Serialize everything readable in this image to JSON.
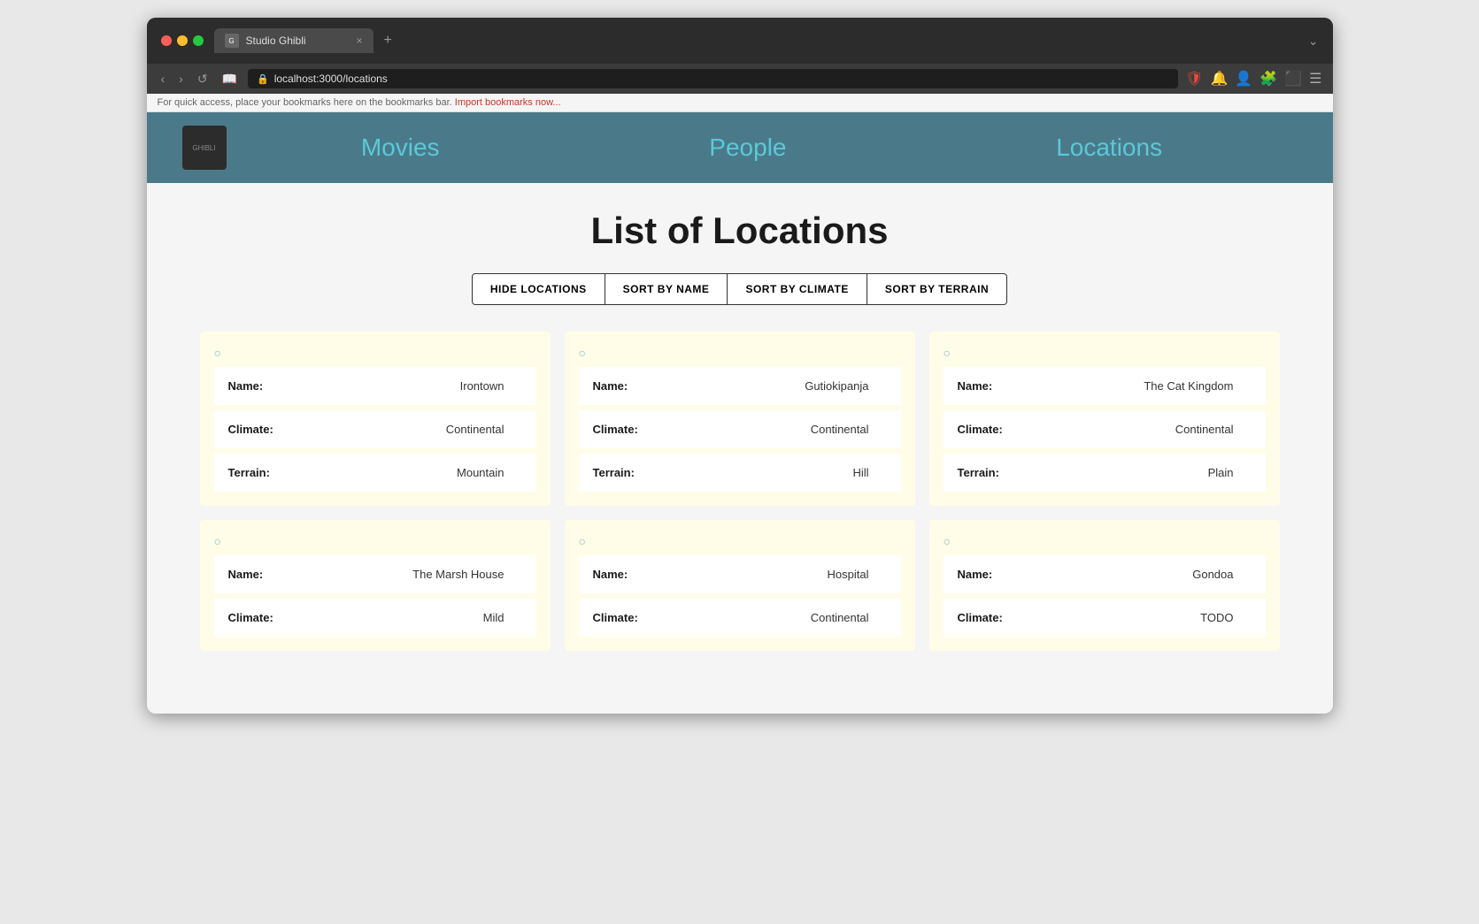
{
  "browser": {
    "tab_title": "Studio Ghibli",
    "url": "localhost:3000/locations",
    "bookmarks_text": "For quick access, place your bookmarks here on the bookmarks bar.",
    "import_link": "Import bookmarks now...",
    "new_tab_symbol": "+",
    "close_tab_symbol": "×"
  },
  "nav": {
    "logo_text": "GHIBLI",
    "links": [
      {
        "label": "Movies",
        "href": "#movies",
        "active": false
      },
      {
        "label": "People",
        "href": "#people",
        "active": false
      },
      {
        "label": "Locations",
        "href": "#locations",
        "active": true
      }
    ]
  },
  "page": {
    "title": "List of Locations",
    "buttons": [
      {
        "id": "hide",
        "label": "HIDE LOCATIONS"
      },
      {
        "id": "name",
        "label": "SORT BY NAME"
      },
      {
        "id": "climate",
        "label": "SORT BY CLIMATE"
      },
      {
        "id": "terrain",
        "label": "SORT BY TERRAIN"
      }
    ],
    "locations": [
      {
        "name": "Irontown",
        "climate": "Continental",
        "terrain": "Mountain"
      },
      {
        "name": "Gutiokipanja",
        "climate": "Continental",
        "terrain": "Hill"
      },
      {
        "name": "The Cat Kingdom",
        "climate": "Continental",
        "terrain": "Plain"
      },
      {
        "name": "The Marsh House",
        "climate": "Mild",
        "terrain": ""
      },
      {
        "name": "Hospital",
        "climate": "Continental",
        "terrain": ""
      },
      {
        "name": "Gondoa",
        "climate": "TODO",
        "terrain": ""
      }
    ]
  }
}
